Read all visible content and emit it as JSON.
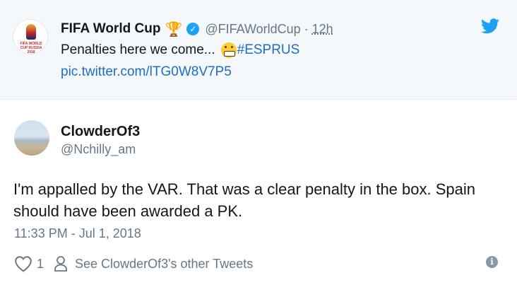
{
  "quoted_tweet": {
    "avatar_text": "FIFA WORLD CUP RUSSIA 2018",
    "name": "FIFA World Cup",
    "handle": "@FIFAWorldCup",
    "separator": "·",
    "time": "12h",
    "text": "Penalties here we come...",
    "hashtag": "#ESPRUS",
    "link": "pic.twitter.com/lTG0W8V7P5",
    "name_emoji_icon": "trophy-icon",
    "text_emoji_icon": "grimacing-face-icon",
    "verified_icon": "verified-badge-icon",
    "brand_icon": "twitter-bird-icon",
    "colors": {
      "background": "#f5f8fa",
      "link": "#1b6ec2",
      "brand": "#1da1f2"
    }
  },
  "tweet": {
    "name": "ClowderOf3",
    "handle": "@Nchilly_am",
    "text": "I'm appalled by the VAR. That was a clear penalty in the box. Spain should have been awarded a PK.",
    "timestamp": "11:33 PM - Jul 1, 2018",
    "like_count": "1",
    "other_tweets_label": "See ClowderOf3's other Tweets",
    "action_icons": [
      "heart-icon",
      "person-icon",
      "info-icon"
    ],
    "colors": {
      "text": "#14171a",
      "secondary": "#657786"
    }
  }
}
